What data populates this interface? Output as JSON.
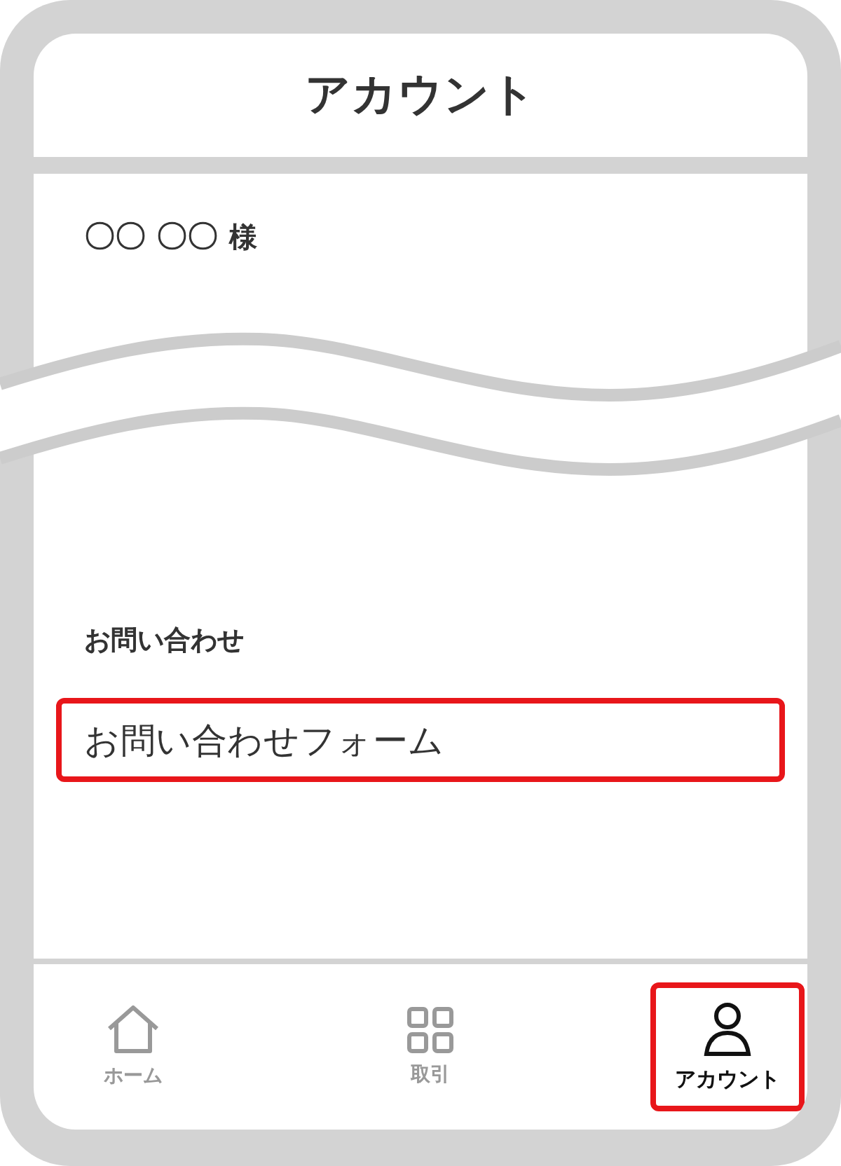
{
  "header": {
    "title": "アカウント"
  },
  "user": {
    "name": "〇〇 〇〇",
    "honorific": "様"
  },
  "section": {
    "heading": "お問い合わせ",
    "link": {
      "label": "お問い合わせフォーム",
      "highlighted": true
    }
  },
  "tab_bar": [
    {
      "label": "ホーム",
      "kind": "home",
      "selected": false,
      "highlighted": false
    },
    {
      "label": "取引",
      "kind": "grid",
      "selected": false,
      "highlighted": false
    },
    {
      "label": "アカウント",
      "kind": "person",
      "selected": true,
      "highlighted": true
    }
  ]
}
